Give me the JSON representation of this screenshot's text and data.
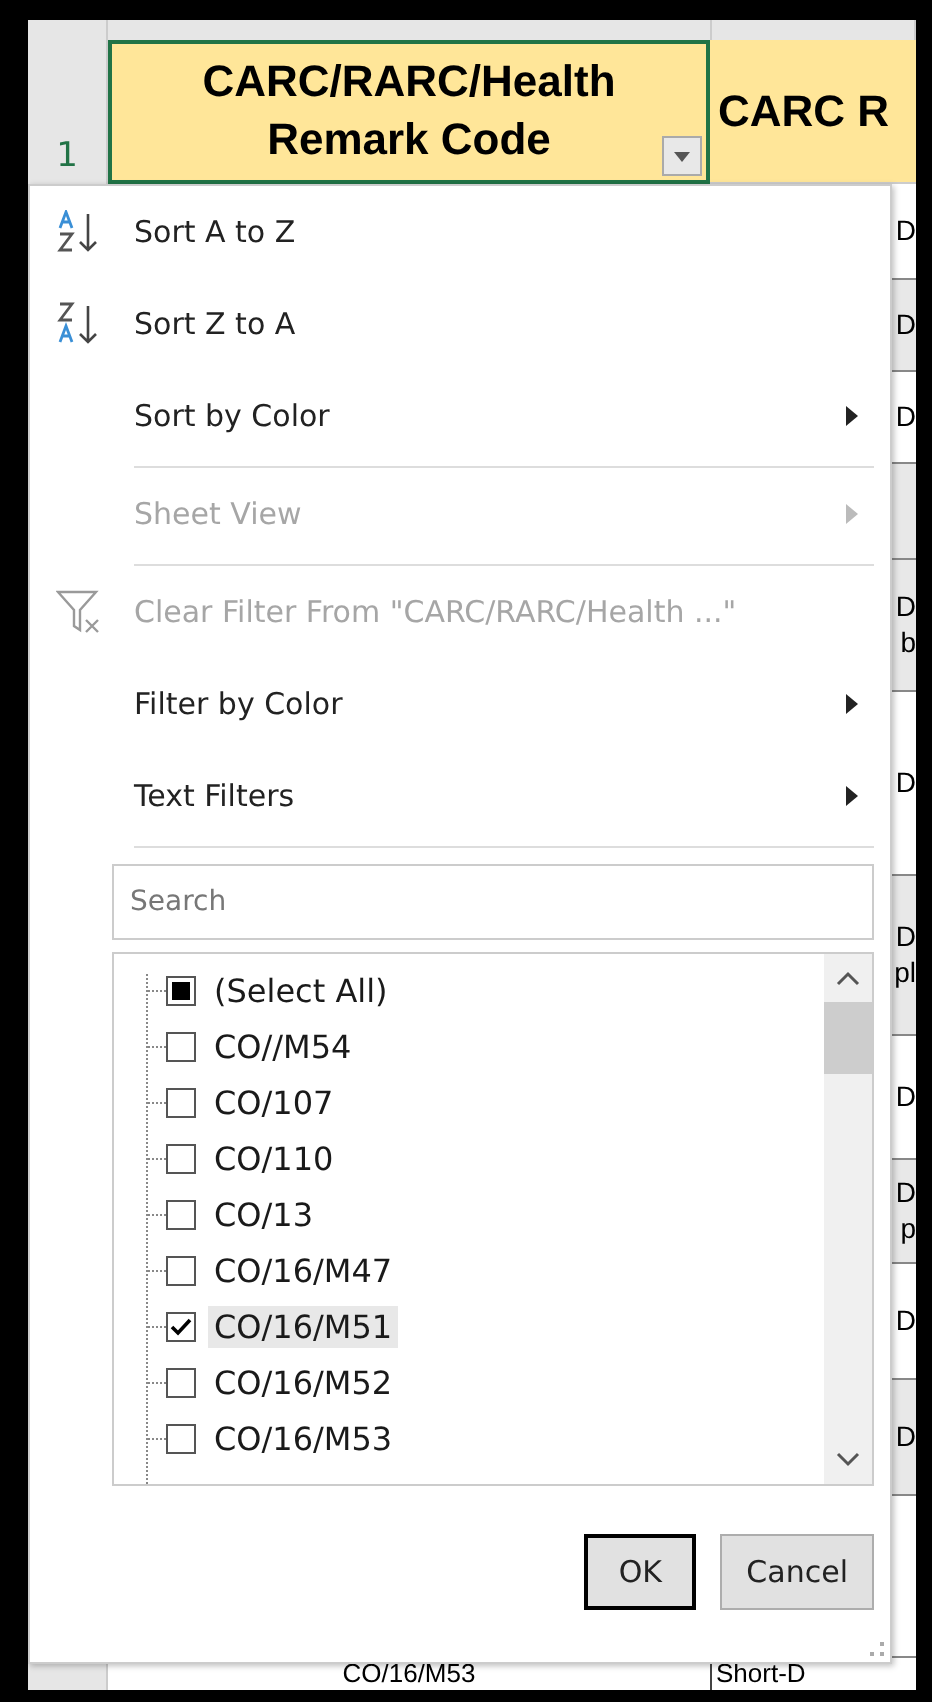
{
  "sheet": {
    "row_number": "1",
    "header_a": "CARC/RARC/Health Remark Code",
    "header_b": "CARC R",
    "column_b_cells": [
      {
        "lines": [
          "D"
        ],
        "shaded": false
      },
      {
        "lines": [
          "D"
        ],
        "shaded": true
      },
      {
        "lines": [
          "D"
        ],
        "shaded": false
      },
      {
        "shaded": true
      },
      {
        "lines": [
          "D",
          "b"
        ],
        "shaded": true
      },
      {
        "lines": [
          "D"
        ],
        "shaded": false
      },
      {
        "lines": [
          "D",
          "pl"
        ],
        "shaded": true
      },
      {
        "lines": [
          "D"
        ],
        "shaded": false
      },
      {
        "lines": [
          "D",
          "p"
        ],
        "shaded": true
      },
      {
        "lines": [
          "D"
        ],
        "shaded": false
      },
      {
        "lines": [
          "D"
        ],
        "shaded": true
      }
    ],
    "bottom_row": {
      "cell_a": "CO/16/M53",
      "cell_b": "Short-D"
    }
  },
  "menu": {
    "items": [
      {
        "kind": "sort-asc",
        "label": "Sort A to Z",
        "disabled": false,
        "submenu": false
      },
      {
        "kind": "sort-desc",
        "label": "Sort Z to A",
        "disabled": false,
        "submenu": false
      },
      {
        "kind": "command",
        "label": "Sort by Color",
        "disabled": false,
        "submenu": true
      },
      {
        "kind": "divider"
      },
      {
        "kind": "command",
        "label": "Sheet View",
        "disabled": true,
        "submenu": true
      },
      {
        "kind": "divider"
      },
      {
        "kind": "clear-filter",
        "label": "Clear Filter From \"CARC/RARC/Health ...\"",
        "disabled": true,
        "submenu": false
      },
      {
        "kind": "command",
        "label": "Filter by Color",
        "disabled": false,
        "submenu": true
      },
      {
        "kind": "command",
        "label": "Text Filters",
        "disabled": false,
        "submenu": true
      },
      {
        "kind": "divider"
      }
    ],
    "search": {
      "placeholder": "Search"
    },
    "values": [
      {
        "label": "(Select All)",
        "checked": false,
        "indeterminate": true,
        "selected": false
      },
      {
        "label": "CO//M54",
        "checked": false,
        "indeterminate": false,
        "selected": false
      },
      {
        "label": "CO/107",
        "checked": false,
        "indeterminate": false,
        "selected": false
      },
      {
        "label": "CO/110",
        "checked": false,
        "indeterminate": false,
        "selected": false
      },
      {
        "label": "CO/13",
        "checked": false,
        "indeterminate": false,
        "selected": false
      },
      {
        "label": "CO/16/M47",
        "checked": false,
        "indeterminate": false,
        "selected": false
      },
      {
        "label": "CO/16/M51",
        "checked": true,
        "indeterminate": false,
        "selected": true
      },
      {
        "label": "CO/16/M52",
        "checked": false,
        "indeterminate": false,
        "selected": false
      },
      {
        "label": "CO/16/M53",
        "checked": false,
        "indeterminate": false,
        "selected": false
      }
    ],
    "buttons": [
      {
        "label": "OK",
        "default": true
      },
      {
        "label": "Cancel",
        "default": false
      }
    ]
  }
}
